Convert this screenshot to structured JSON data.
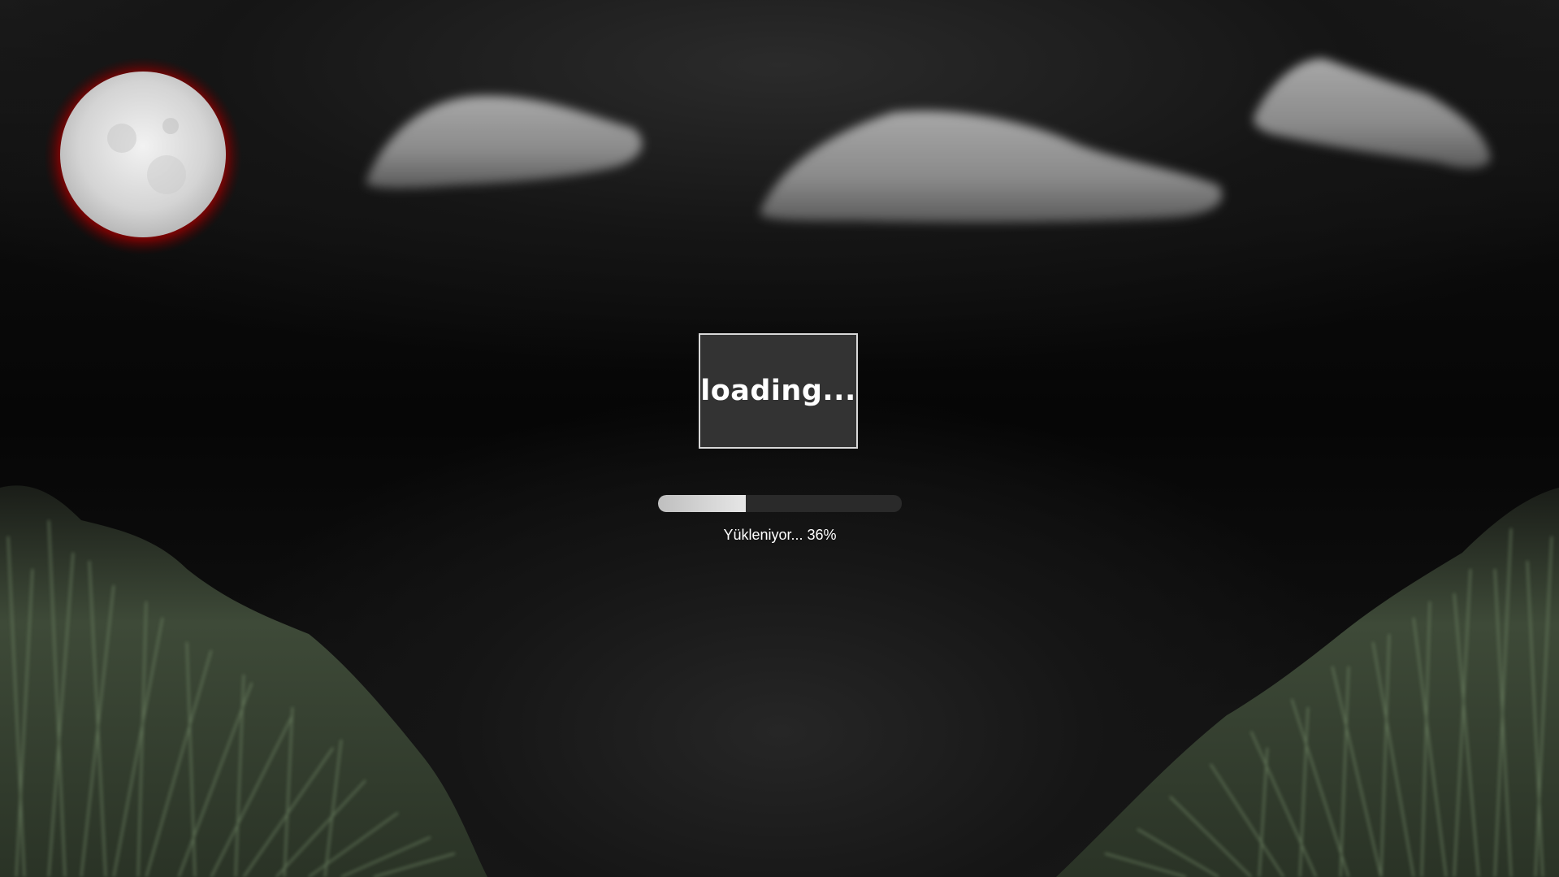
{
  "loading_box": {
    "title": "loading..."
  },
  "progress": {
    "label": "Yükleniyor... 36%",
    "value": 0.36
  },
  "colors": {
    "moon_glow": "#c00000",
    "moon_face": "#e0e0e0",
    "grass": "#5f7356",
    "progress_fill": "#d9d9d9",
    "box_bg": "#333333"
  },
  "icons": {
    "moon": "moon-icon",
    "cloud": "cloud-icon",
    "grass": "grass-icon"
  }
}
